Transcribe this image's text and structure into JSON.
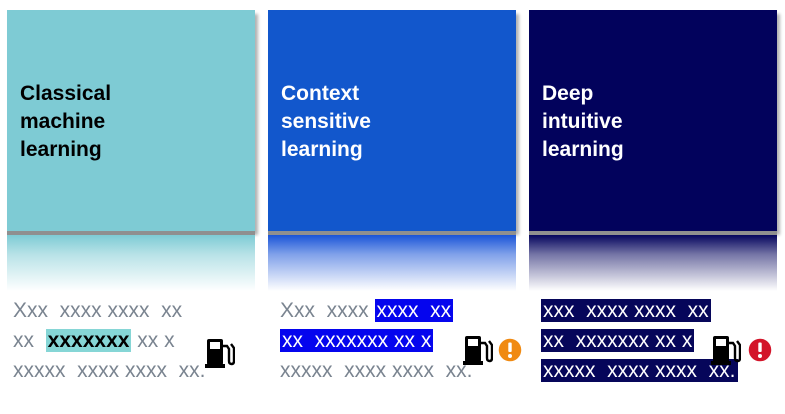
{
  "columns": [
    {
      "title": [
        "Classical",
        "machine",
        "learning"
      ],
      "lines": [
        [
          {
            "t": "Xxx  xxxx xxxx  xx"
          }
        ],
        [
          {
            "t": "xx  "
          },
          {
            "t": "xxxxxxx",
            "hl": "green"
          },
          {
            "t": " xx x"
          }
        ],
        [
          {
            "t": "xxxxx  xxxx xxxx  xx."
          }
        ]
      ]
    },
    {
      "title": [
        "Context",
        "sensitive",
        "learning"
      ],
      "lines": [
        [
          {
            "t": "Xxx  xxxx "
          },
          {
            "t": "xxxx  xx",
            "hl": "blue"
          }
        ],
        [
          {
            "t": "xx  xxxxxxx xx x",
            "hl": "blue"
          }
        ],
        [
          {
            "t": "xxxxx  xxxx xxxx  xx."
          }
        ]
      ]
    },
    {
      "title": [
        "Deep",
        "intuitive",
        "learning"
      ],
      "lines": [
        [
          {
            "t": "xxx  xxxx xxxx  xx",
            "hl": "navy"
          }
        ],
        [
          {
            "t": "xx  xxxxxxx xx x",
            "hl": "navy"
          }
        ],
        [
          {
            "t": "xxxxx  xxxx xxxx  xx.",
            "hl": "navy"
          }
        ]
      ]
    }
  ],
  "icons": {
    "pump": "fuel-pump-icon",
    "warning_orange": "warning-orange-icon",
    "warning_red": "warning-red-icon"
  },
  "colors": {
    "card1": "#7ecbd4",
    "card2": "#1257cc",
    "card3": "#02025c",
    "text_gray": "#7a8490",
    "warn_orange": "#f08a12",
    "warn_red": "#d3152a"
  }
}
